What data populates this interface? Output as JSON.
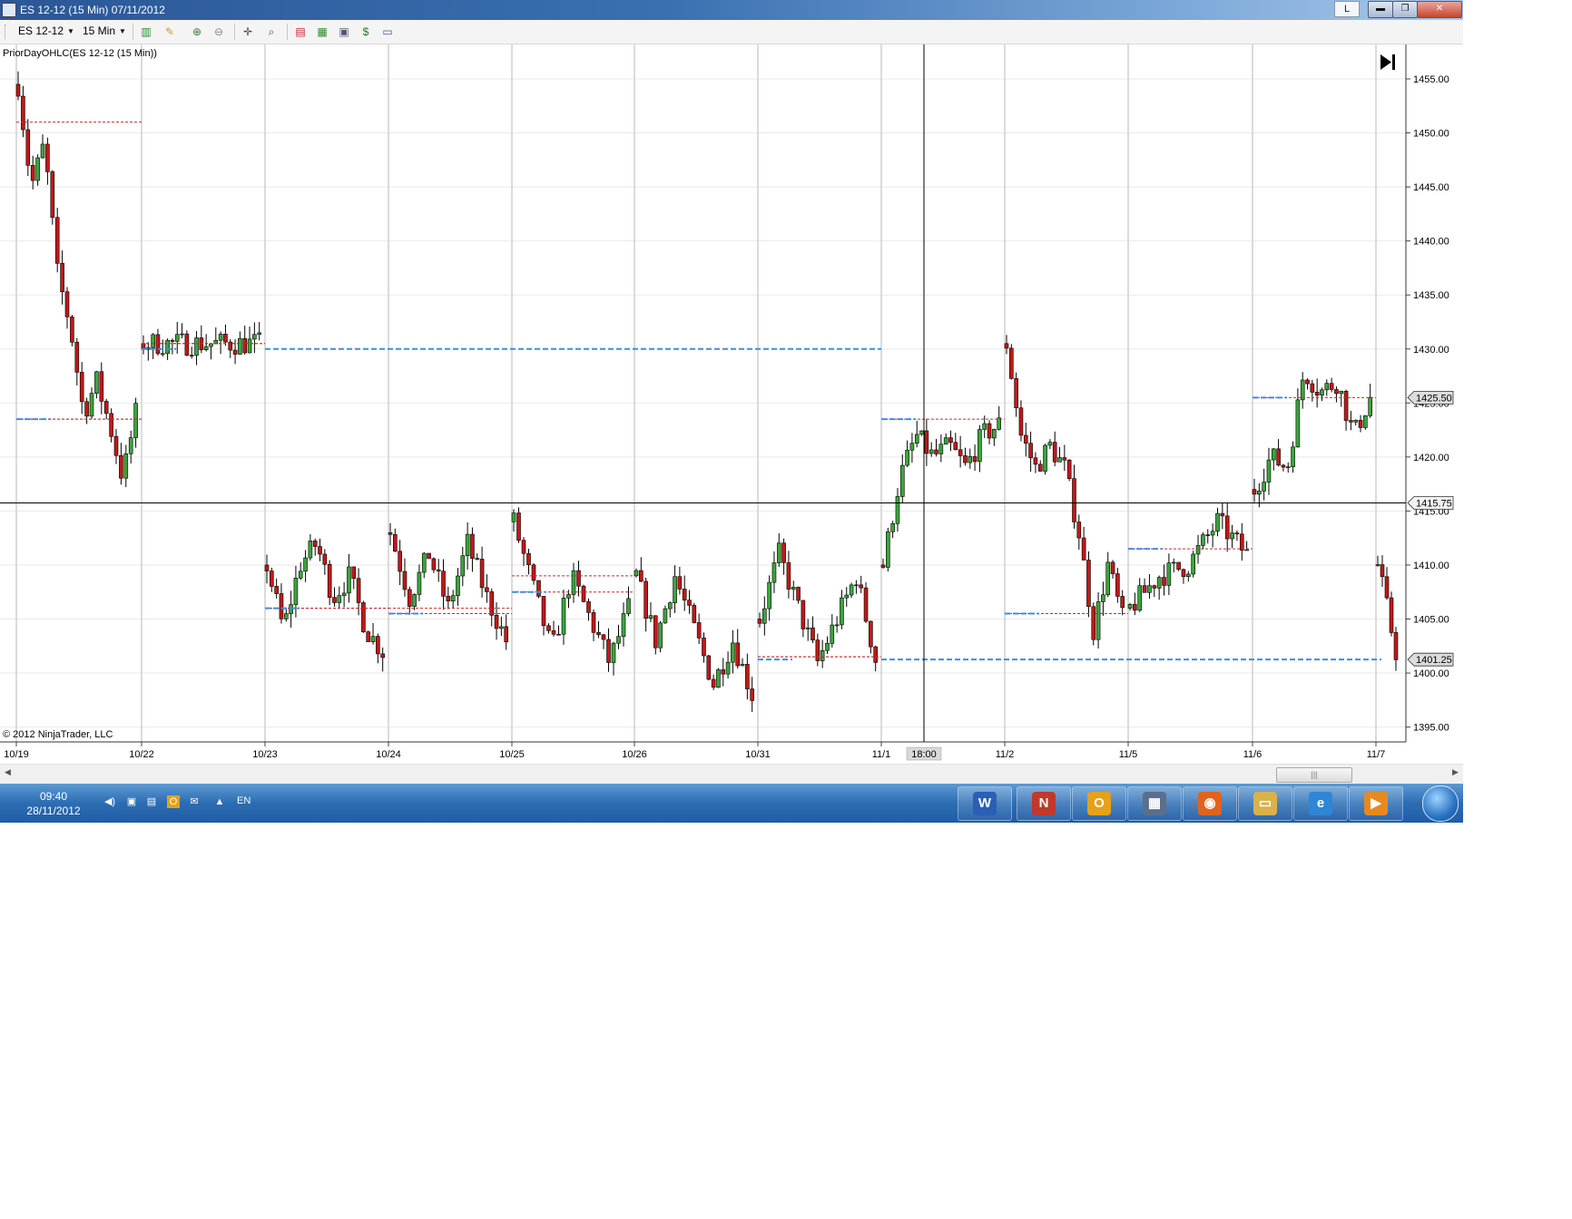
{
  "window": {
    "title": "ES 12-12 (15 Min)  07/11/2012",
    "keyboard_indicator": "L",
    "controls": {
      "minimize": "▬",
      "maximize": "❐",
      "close": "✕"
    }
  },
  "toolbar": {
    "instrument": "ES 12-12",
    "interval": "15 Min",
    "icons": [
      "candlestick-style-icon",
      "draw-pencil-icon",
      "zoom-in-icon",
      "zoom-out-icon",
      "crosshair-icon",
      "magnifier-icon",
      "bar-style-icon",
      "chart-style-icon",
      "data-box-icon",
      "dollar-icon",
      "properties-icon"
    ]
  },
  "chart_data": {
    "type": "candlestick",
    "indicator_label": "PriorDayOHLC(ES 12-12 (15 Min))",
    "copyright": "© 2012 NinjaTrader, LLC",
    "x_labels": [
      "10/19",
      "10/22",
      "10/23",
      "10/24",
      "10/25",
      "10/26",
      "10/31",
      "11/1",
      "11/2",
      "11/5",
      "11/6",
      "11/7"
    ],
    "y_ticks": [
      "1455.00",
      "1450.00",
      "1445.00",
      "1440.00",
      "1435.00",
      "1430.00",
      "1425.00",
      "1420.00",
      "1415.00",
      "1410.00",
      "1405.00",
      "1400.00",
      "1395.00"
    ],
    "ylim": [
      1393,
      1460
    ],
    "crosshair": {
      "time_label": "18:00",
      "price_label": "1415.75"
    },
    "last_price_label": "1425.50",
    "prior_low_label": "1401.25",
    "colors": {
      "up": "#3aa63a",
      "down": "#c21818",
      "prior_day_ohlc": "#c03030",
      "prior_day_range": "#3a8ee6"
    },
    "day_paths": [
      [
        1454.5,
        1445,
        1449,
        1437,
        1432,
        1424,
        1427,
        1423,
        1418,
        1424
      ],
      [
        1430.5
      ],
      [
        1410,
        1404,
        1410,
        1412,
        1407,
        1409,
        1404,
        1402
      ],
      [
        1413,
        1407,
        1411,
        1406,
        1412,
        1407,
        1403
      ],
      [
        1414,
        1408,
        1402,
        1409,
        1405,
        1401,
        1406
      ],
      [
        1409,
        1403,
        1409,
        1404,
        1399,
        1403,
        1398
      ],
      [
        1405,
        1411,
        1406,
        1401,
        1405,
        1409,
        1401.25
      ],
      [
        1410,
        1418,
        1422,
        1420,
        1421,
        1419,
        1422,
        1423
      ],
      [
        1430.5,
        1422,
        1419,
        1421,
        1419,
        1413,
        1404,
        1410,
        1405
      ],
      [
        1406,
        1409,
        1410,
        1414,
        1411
      ],
      [
        1417,
        1420,
        1419,
        1428,
        1426,
        1427,
        1422,
        1425.5
      ],
      [
        1410,
        1402
      ]
    ],
    "prior_day_lines": [
      {
        "day": 0,
        "ohlc": [
          1451,
          1423.5,
          1423.5
        ],
        "range": 1423.5
      },
      {
        "day": 1,
        "ohlc": [
          1430.5,
          1430.5
        ],
        "range": 1430
      },
      {
        "day": 2,
        "ohlc": [
          1406,
          1406
        ],
        "range": 1406
      },
      {
        "day": 3,
        "ohlc": [
          1406,
          1405.5
        ],
        "range": 1405.5
      },
      {
        "day": 4,
        "ohlc": [
          1409,
          1407.5
        ],
        "range": 1407.5
      },
      {
        "day": 6,
        "ohlc": [
          1401.5,
          1401.5
        ],
        "range": 1401.25
      },
      {
        "day": 7,
        "ohlc": [
          1423.5
        ],
        "range": 1423.5
      },
      {
        "day": 8,
        "ohlc": [
          1405.5
        ],
        "range": 1405.5
      },
      {
        "day": 9,
        "ohlc": [
          1411.5
        ],
        "range": 1411.5
      },
      {
        "day": 10,
        "ohlc": [
          1425.5
        ],
        "range": 1425.5
      }
    ],
    "range_spans": [
      {
        "from_day": 2,
        "to_day": 7,
        "price": 1430
      },
      {
        "from_day": 7,
        "to_day": 11,
        "price": 1401.25
      }
    ]
  },
  "taskbar": {
    "time": "09:40",
    "date": "28/11/2012",
    "language": "EN",
    "apps": [
      {
        "name": "word",
        "glyph": "W",
        "color": "#2b5fb4"
      },
      {
        "name": "ninjatrader",
        "glyph": "N",
        "color": "#c0392b"
      },
      {
        "name": "outlook",
        "glyph": "O",
        "color": "#e6a117"
      },
      {
        "name": "calculator",
        "glyph": "▦",
        "color": "#5a6f8c"
      },
      {
        "name": "firefox",
        "glyph": "◉",
        "color": "#e0631d"
      },
      {
        "name": "explorer",
        "glyph": "▭",
        "color": "#d9b24a"
      },
      {
        "name": "internet-explorer",
        "glyph": "e",
        "color": "#2f86d6"
      },
      {
        "name": "media-player",
        "glyph": "▶",
        "color": "#e68a1f"
      }
    ]
  }
}
